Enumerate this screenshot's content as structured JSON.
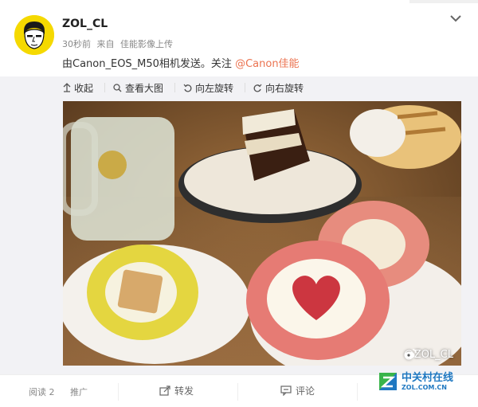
{
  "post": {
    "author": "ZOL_CL",
    "time": "30秒前",
    "source_prefix": "来自",
    "source": "佳能影像上传",
    "text_before": "由Canon_EOS_M50相机发送。关注 ",
    "mention": "@Canon佳能"
  },
  "toolbar": {
    "collapse": "收起",
    "view_large": "查看大图",
    "rotate_left": "向左旋转",
    "rotate_right": "向右旋转"
  },
  "photo": {
    "watermark": "@ZOL_CL",
    "icons": [
      "weibo-icon"
    ]
  },
  "footer": {
    "read_label": "阅读 2",
    "promote": "推广",
    "forward": "转发",
    "comment": "评论"
  },
  "logo": {
    "name": "中关村在线",
    "sub": "ZOL.COM.CN"
  },
  "colors": {
    "mention": "#eb7350",
    "avatar_bg": "#f5d900",
    "logo": "#1f78c1"
  }
}
